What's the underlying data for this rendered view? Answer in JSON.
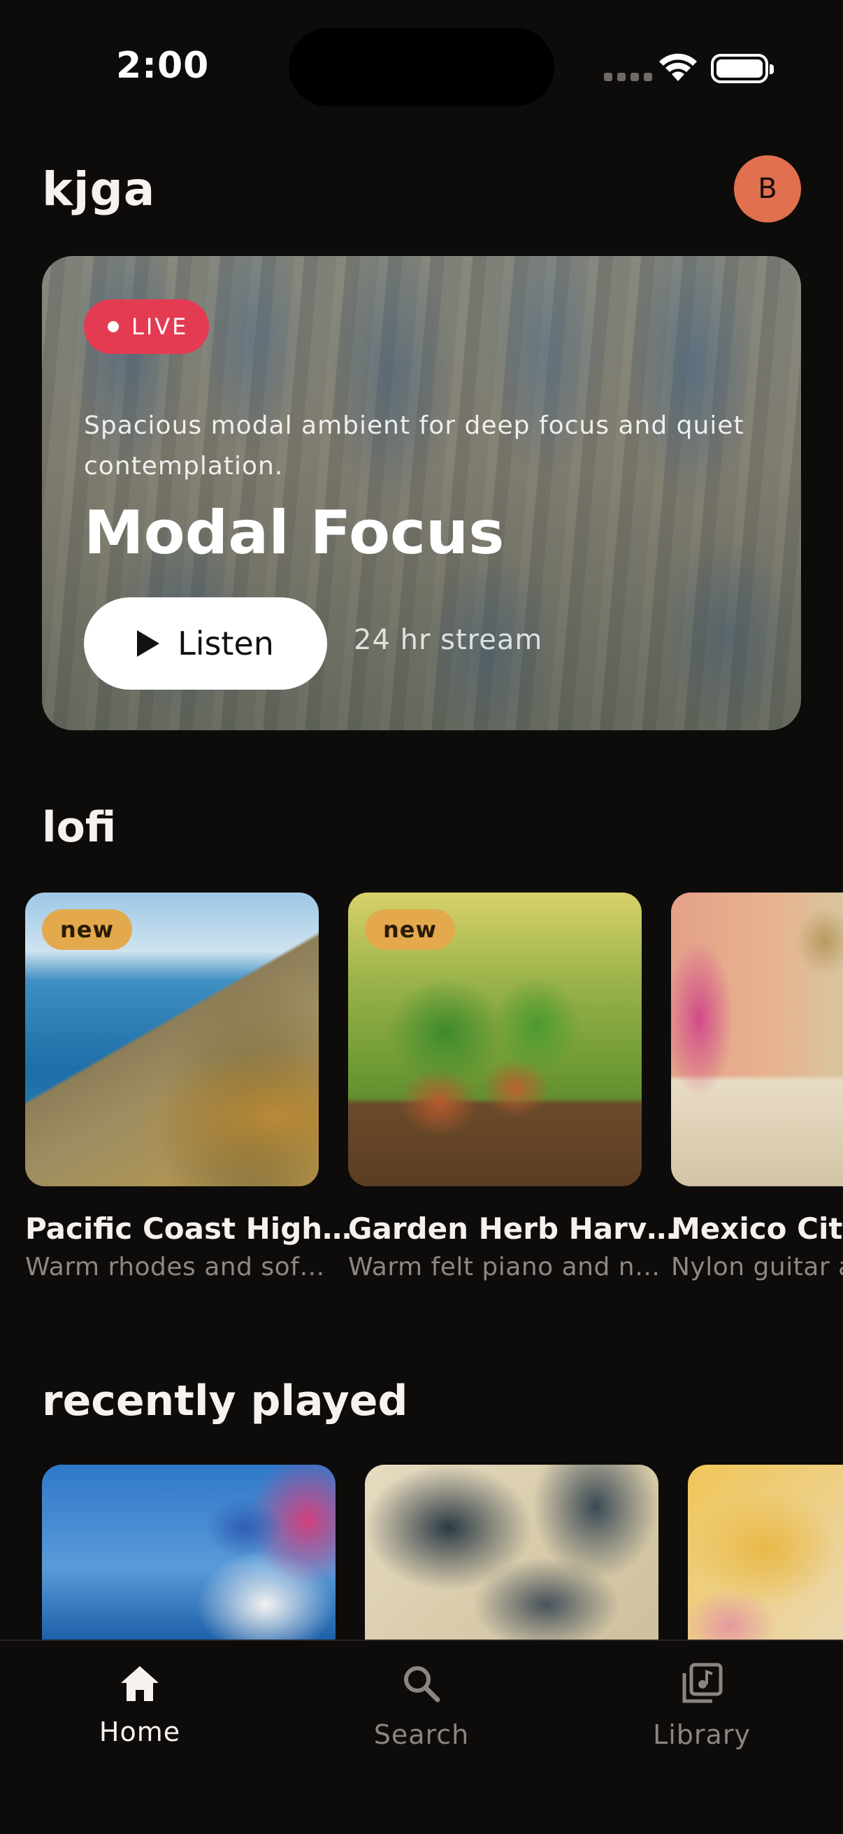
{
  "status_bar": {
    "time": "2:00"
  },
  "header": {
    "title": "kjga",
    "avatar_initial": "B"
  },
  "hero": {
    "badge": "LIVE",
    "description": "Spacious modal ambient for deep focus and quiet contemplation.",
    "title": "Modal Focus",
    "button_label": "Listen",
    "meta": "24 hr stream"
  },
  "sections": {
    "lofi": {
      "title": "lofi",
      "cards": [
        {
          "badge": "new",
          "title": "Pacific Coast High…",
          "subtitle": "Warm rhodes and sof…"
        },
        {
          "badge": "new",
          "title": "Garden Herb Harv…",
          "subtitle": "Warm felt piano and n…"
        },
        {
          "title": "Mexico City",
          "subtitle": "Nylon guitar a"
        }
      ]
    },
    "recent": {
      "title": "recently played"
    }
  },
  "nav": {
    "items": [
      {
        "label": "Home",
        "icon": "home-icon",
        "active": true
      },
      {
        "label": "Search",
        "icon": "search-icon",
        "active": false
      },
      {
        "label": "Library",
        "icon": "library-icon",
        "active": false
      }
    ]
  },
  "colors": {
    "background": "#0e0b0b",
    "accent_live": "#e43b52",
    "avatar": "#e0704f",
    "badge_new": "#e3a94c"
  }
}
